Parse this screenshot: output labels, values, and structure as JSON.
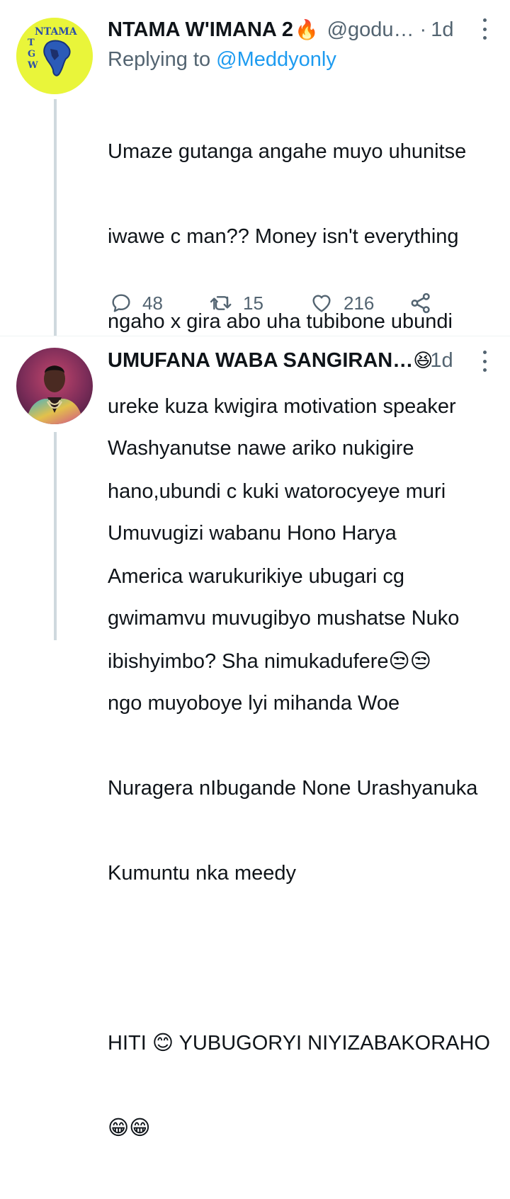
{
  "tweet1": {
    "name": "NTAMA W'IMANA 2",
    "name_emoji": "🔥",
    "handle": "@godu…",
    "dot": "·",
    "time": "1d",
    "replying_prefix": "Replying to",
    "replying_mention": "@Meddyonly",
    "avatar_text": {
      "top": "NTAMA",
      "left_col": "T G W"
    },
    "body_lines": [
      "Umaze gutanga angahe muyo uhunitse",
      "iwawe c man?? Money isn't everything",
      "ngaho x gira abo uha tubibone ubundi",
      "ureke kuza kwigira motivation speaker",
      "hano,ubundi c kuki watorocyeye muri",
      "America warukurikiye ubugari cg",
      "ibishyimbo? Sha nimukadufere😒😒"
    ],
    "reply_count": "48",
    "retweet_count": "15",
    "like_count": "216"
  },
  "tweet2": {
    "name": "UMUFANA WABA SANGIRAN…",
    "name_emoji": "😆",
    "time": "1d",
    "body_lines": [
      "Washyanutse nawe ariko nukigire",
      "Umuvugizi wabanu Hono Harya",
      "gwimamvu muvugibyo mushatse Nuko",
      "ngo muyoboye lyi mihanda Woe",
      "Nuragera nIbugande None Urashyanuka",
      "Kumuntu nka meedy",
      "",
      "HITI 😊 YUBUGORYI NIYIZABAKORAHO",
      "😁😁"
    ]
  },
  "icons": [
    "reply-icon",
    "retweet-icon",
    "like-icon",
    "share-icon",
    "more-icon"
  ],
  "colors": {
    "text": "#0f1419",
    "secondary": "#536471",
    "link": "#1d9bf0",
    "thread": "#cfd9de"
  }
}
